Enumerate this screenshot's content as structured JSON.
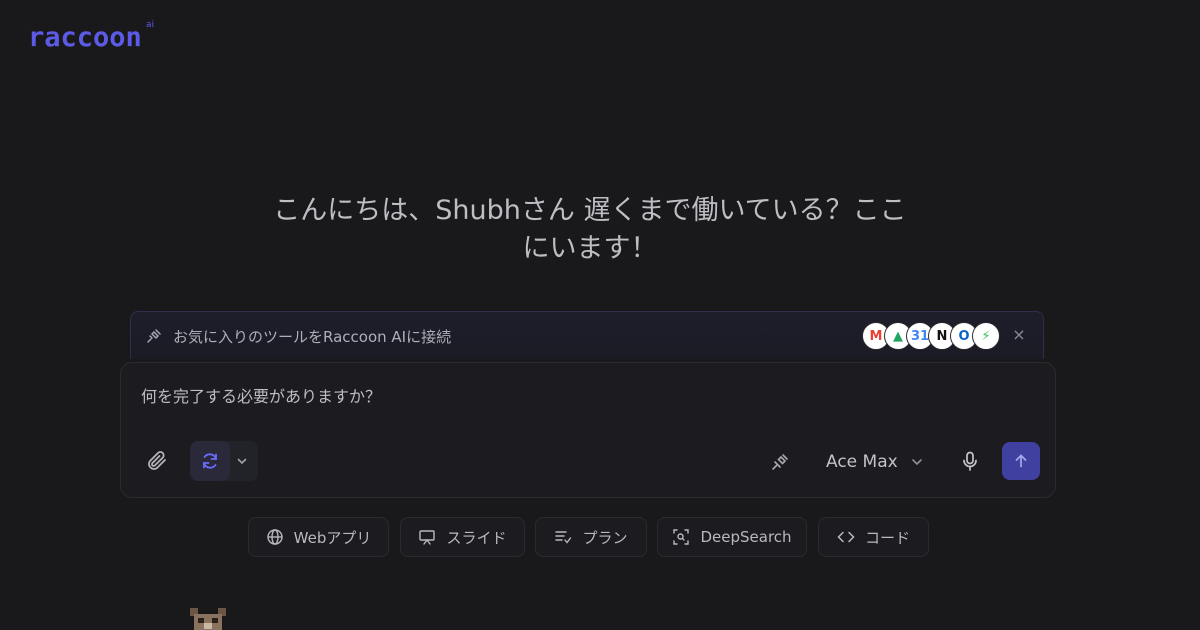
{
  "brand": {
    "name": "raccoon",
    "sup": "ai",
    "color": "#5b5be6"
  },
  "greeting": {
    "line1": "こんにちは、Shubhさん 遅くまで働いている？ここ",
    "line2": "にいます！"
  },
  "banner": {
    "text": "お気に入りのツールをRaccoon AIに接続",
    "apps": [
      {
        "name": "gmail-icon",
        "glyph": "M",
        "color": "#ea4335"
      },
      {
        "name": "google-drive-icon",
        "glyph": "▲",
        "color": "#1fa463"
      },
      {
        "name": "google-calendar-icon",
        "glyph": "31",
        "color": "#4285f4"
      },
      {
        "name": "notion-icon",
        "glyph": "N",
        "color": "#111111"
      },
      {
        "name": "outlook-icon",
        "glyph": "O",
        "color": "#0a64c8"
      },
      {
        "name": "zap-icon",
        "glyph": "⚡",
        "color": "#2fc35a"
      }
    ],
    "close": "×"
  },
  "composer": {
    "placeholder": "何を完了する必要がありますか？",
    "model": "Ace Max"
  },
  "chips": [
    {
      "label": "Webアプリ",
      "icon": "globe-icon"
    },
    {
      "label": "スライド",
      "icon": "presentation-icon"
    },
    {
      "label": "プラン",
      "icon": "plan-list-icon"
    },
    {
      "label": "DeepSearch",
      "icon": "deep-search-icon"
    },
    {
      "label": "コード",
      "icon": "code-icon"
    }
  ],
  "colors": {
    "accent": "#5b5be6",
    "send": "#4040a0",
    "background": "#19191c"
  }
}
